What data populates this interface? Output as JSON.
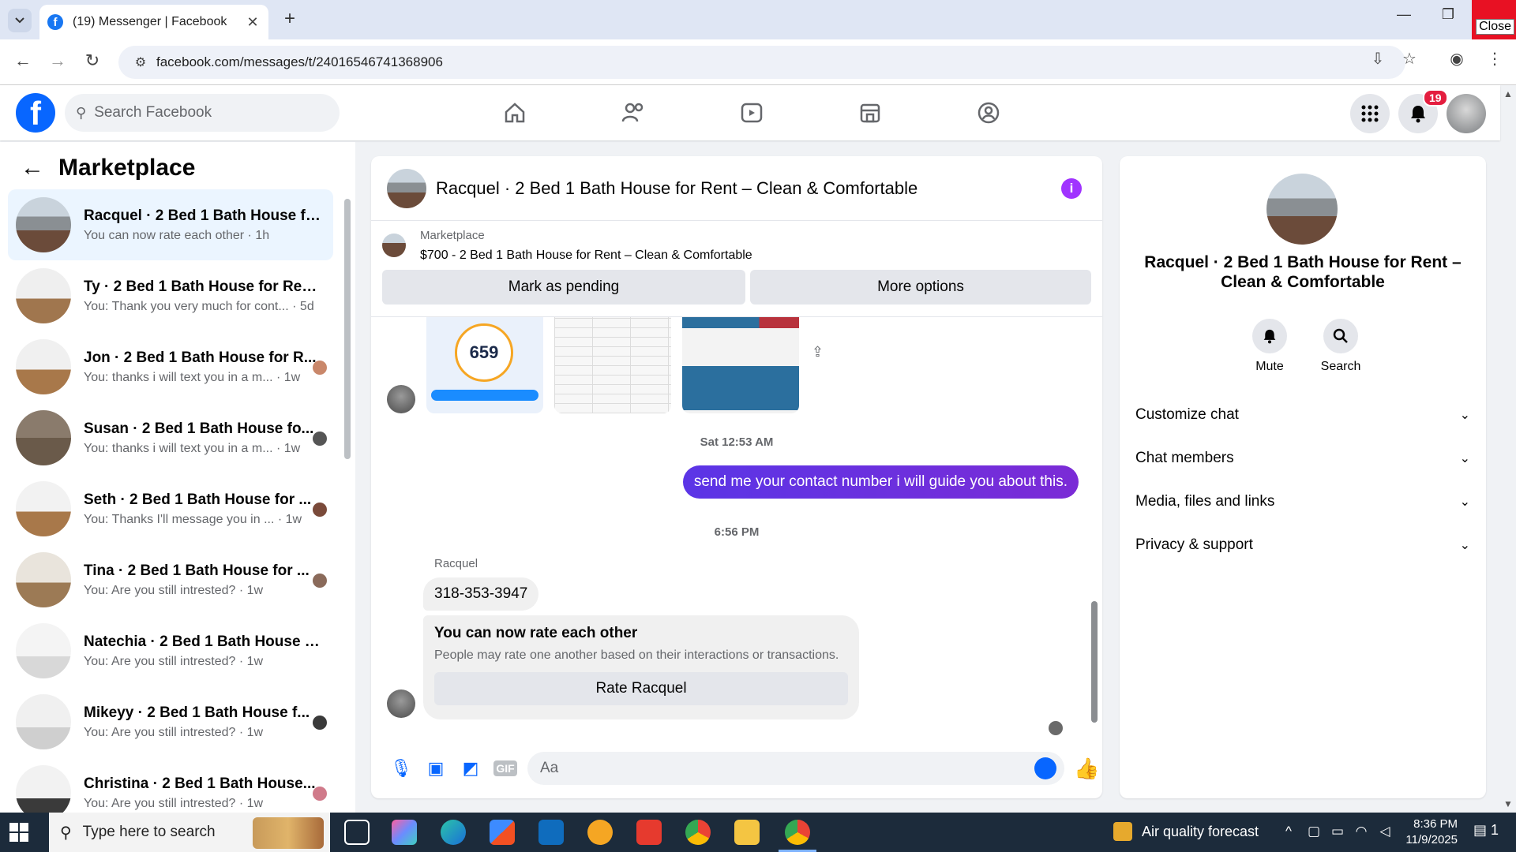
{
  "browser": {
    "tab_title": "(19) Messenger | Facebook",
    "url": "facebook.com/messages/t/24016546741368906",
    "close_tooltip": "Close"
  },
  "fb": {
    "search_placeholder": "Search Facebook",
    "notification_count": "19"
  },
  "sidebar": {
    "heading": "Marketplace",
    "chats": [
      {
        "name": "Racquel · 2 Bed 1 Bath House fo...",
        "preview": "You can now rate each other · 1h",
        "active": true
      },
      {
        "name": "Ty · 2 Bed 1 Bath House for Rent...",
        "preview": "You: Thank you very much for cont... · 5d"
      },
      {
        "name": "Jon · 2 Bed 1 Bath House for R...",
        "preview": "You: thanks i will text you in a m... · 1w"
      },
      {
        "name": "Susan · 2 Bed 1 Bath House fo...",
        "preview": "You: thanks i will text you in a m... · 1w"
      },
      {
        "name": "Seth · 2 Bed 1 Bath House for ...",
        "preview": "You: Thanks I'll message you in ... · 1w"
      },
      {
        "name": "Tina · 2 Bed 1 Bath House for ...",
        "preview": "You: Are you still intrested? · 1w"
      },
      {
        "name": "Natechia · 2 Bed 1 Bath House f...",
        "preview": "You: Are you still intrested? · 1w"
      },
      {
        "name": "Mikeyy · 2 Bed 1 Bath House f...",
        "preview": "You: Are you still intrested? · 1w"
      },
      {
        "name": "Christina · 2 Bed 1 Bath House...",
        "preview": "You: Are you still intrested? · 1w"
      }
    ]
  },
  "conversation": {
    "title": "Racquel · 2 Bed 1 Bath House for Rent – Clean & Comfortable",
    "marketplace_label": "Marketplace",
    "listing": "$700 - 2 Bed 1 Bath House for Rent – Clean & Comfortable",
    "mark_pending": "Mark as pending",
    "more_options": "More options",
    "credit_score": "659",
    "timestamp1": "Sat 12:53 AM",
    "outgoing_msg": "send me your contact number i will guide you about this.",
    "timestamp2": "6:56 PM",
    "sender_name": "Racquel",
    "incoming_msg": "318-353-3947",
    "rate_heading": "You can now rate each other",
    "rate_sub": "People may rate one another based on their interactions or transactions.",
    "rate_button": "Rate Racquel",
    "composer_placeholder": "Aa"
  },
  "info_panel": {
    "name": "Racquel · 2 Bed 1 Bath House for Rent – Clean & Comfortable",
    "mute": "Mute",
    "search": "Search",
    "sections": [
      "Customize chat",
      "Chat members",
      "Media, files and links",
      "Privacy & support"
    ]
  },
  "taskbar": {
    "search_placeholder": "Type here to search",
    "weather": "Air quality forecast",
    "time": "8:36 PM",
    "date": "11/9/2025",
    "notif_count": "1"
  },
  "colors": {
    "accent": "#0866ff",
    "outgoing_bubble": "#6c2bd9",
    "active_chat": "#ebf5ff",
    "notification_badge": "#e41e3f",
    "info_icon": "#a033ff"
  }
}
